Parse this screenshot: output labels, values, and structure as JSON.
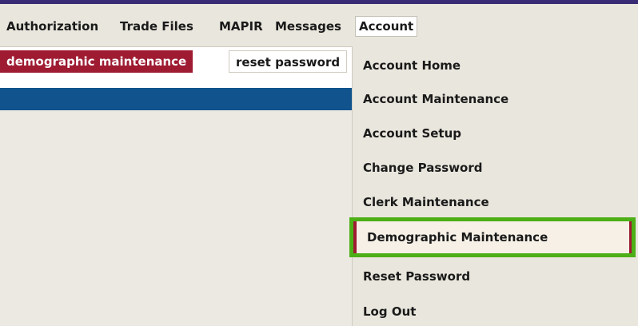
{
  "menubar": {
    "items": [
      "Authorization",
      "Trade Files",
      "MAPIR",
      "Messages",
      "Account"
    ],
    "active": "Account"
  },
  "subnav": {
    "tabs": [
      {
        "label": "demographic maintenance",
        "active": true
      },
      {
        "label": "reset password",
        "active": false
      }
    ]
  },
  "account_menu": {
    "items": [
      "Account Home",
      "Account Maintenance",
      "Account Setup",
      "Change Password",
      "Clerk Maintenance",
      "Demographic Maintenance",
      "Reset Password",
      "Log Out"
    ],
    "highlighted": "Demographic Maintenance"
  },
  "colors": {
    "top_rule": "#3a2c74",
    "active_tab": "#9e1b32",
    "blue_bar": "#10538d",
    "highlight_border": "#4caf16",
    "menu_bg": "#e9e6dd"
  }
}
